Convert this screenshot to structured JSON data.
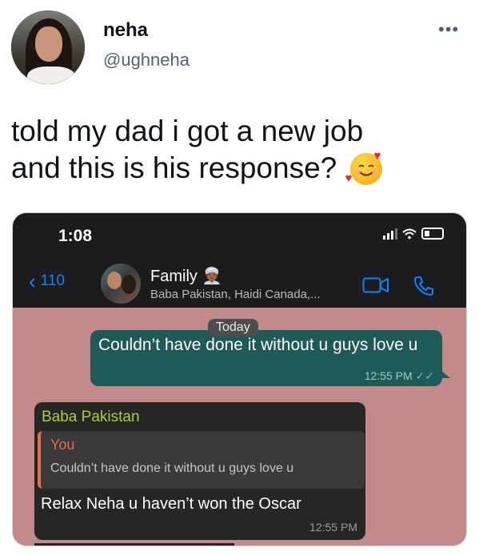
{
  "tweet": {
    "display_name": "neha",
    "handle": "@ughneha",
    "more_label": "•••",
    "text_line1": "told my dad i got a new job",
    "text_line2": "and this is his response?",
    "emoji_icon": "smiling-face-with-hearts-icon"
  },
  "phone": {
    "status": {
      "time": "1:08"
    },
    "header": {
      "back_count": "110",
      "back_chevron": "‹",
      "title": "Family 👳🏾",
      "subtitle": "Baba Pakistan, Haidi Canada,..."
    },
    "date_badge": "Today",
    "messages": [
      {
        "direction": "outgoing",
        "text": "Couldn’t have done it without u guys love u",
        "time": "12:55 PM",
        "read_ticks": "✓✓"
      },
      {
        "direction": "incoming",
        "sender": "Baba Pakistan",
        "quoted_sender": "You",
        "quoted_text": "Couldn’t have done it without u guys love u",
        "text": "Relax Neha u haven’t won the Oscar",
        "time": "12:55 PM"
      }
    ],
    "colors": {
      "chat_bg": "#c38a8c",
      "header_bg": "#1c1c1e",
      "outgoing_bubble": "#1e5b58",
      "incoming_bubble": "#262626",
      "sender_name": "#a6ce39",
      "quote_accent": "#e66f4f",
      "accent_blue": "#0a84ff"
    }
  }
}
